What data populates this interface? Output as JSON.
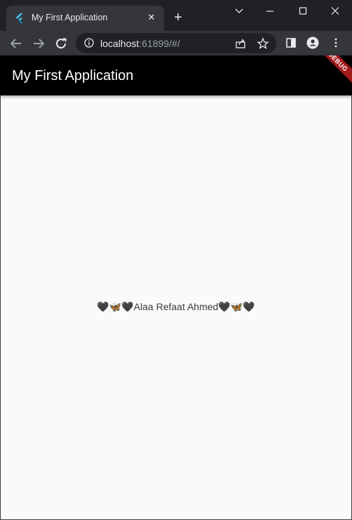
{
  "browser": {
    "tab_title": "My First Application",
    "tab_close": "✕",
    "new_tab": "+",
    "url_host": "localhost",
    "url_rest": ":61899/#/",
    "window_controls": {
      "minimize": "—",
      "maximize": "☐",
      "close": "✕"
    },
    "icons": [
      "back-icon",
      "forward-icon",
      "reload-icon",
      "info-icon",
      "share-icon",
      "star-icon",
      "side-panel-icon",
      "profile-icon",
      "menu-icon"
    ]
  },
  "app": {
    "title": "My First Application",
    "debug_label": "DEBUG",
    "center_text": "🖤🦋🖤Alaa Refaat Ahmed🖤🦋🖤"
  },
  "colors": {
    "appbar": "#000000",
    "debug_banner": "#a31b1b",
    "background": "#fafafa",
    "flutter_blue": "#47c5fb"
  }
}
